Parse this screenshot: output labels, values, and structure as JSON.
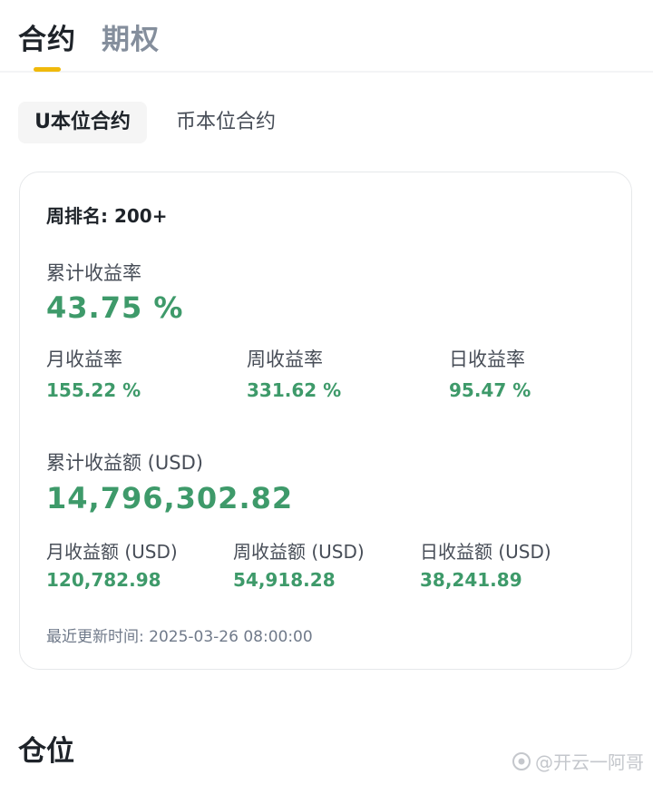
{
  "top_tabs": {
    "active": "合约",
    "inactive": "期权"
  },
  "sub_tabs": {
    "active": "U本位合约",
    "inactive": "币本位合约"
  },
  "card": {
    "rank": "周排名: 200+",
    "cumulative_rate_label": "累计收益率",
    "cumulative_rate_value": "43.75 %",
    "rates": [
      {
        "label": "月收益率",
        "value": "155.22 %"
      },
      {
        "label": "周收益率",
        "value": "331.62 %"
      },
      {
        "label": "日收益率",
        "value": "95.47 %"
      }
    ],
    "cumulative_amount_label": "累计收益额 (USD)",
    "cumulative_amount_value": "14,796,302.82",
    "amounts": [
      {
        "label": "月收益额 (USD)",
        "value": "120,782.98"
      },
      {
        "label": "周收益额 (USD)",
        "value": "54,918.28"
      },
      {
        "label": "日收益额 (USD)",
        "value": "38,241.89"
      }
    ],
    "updated": "最近更新时间:  2025-03-26 08:00:00"
  },
  "positions_title": "仓位",
  "watermark": "@开云一阿哥",
  "colors": {
    "accent": "#f0b90b",
    "profit_green": "#3e9a6a",
    "text_primary": "#1e2329",
    "text_secondary": "#848e9c"
  }
}
